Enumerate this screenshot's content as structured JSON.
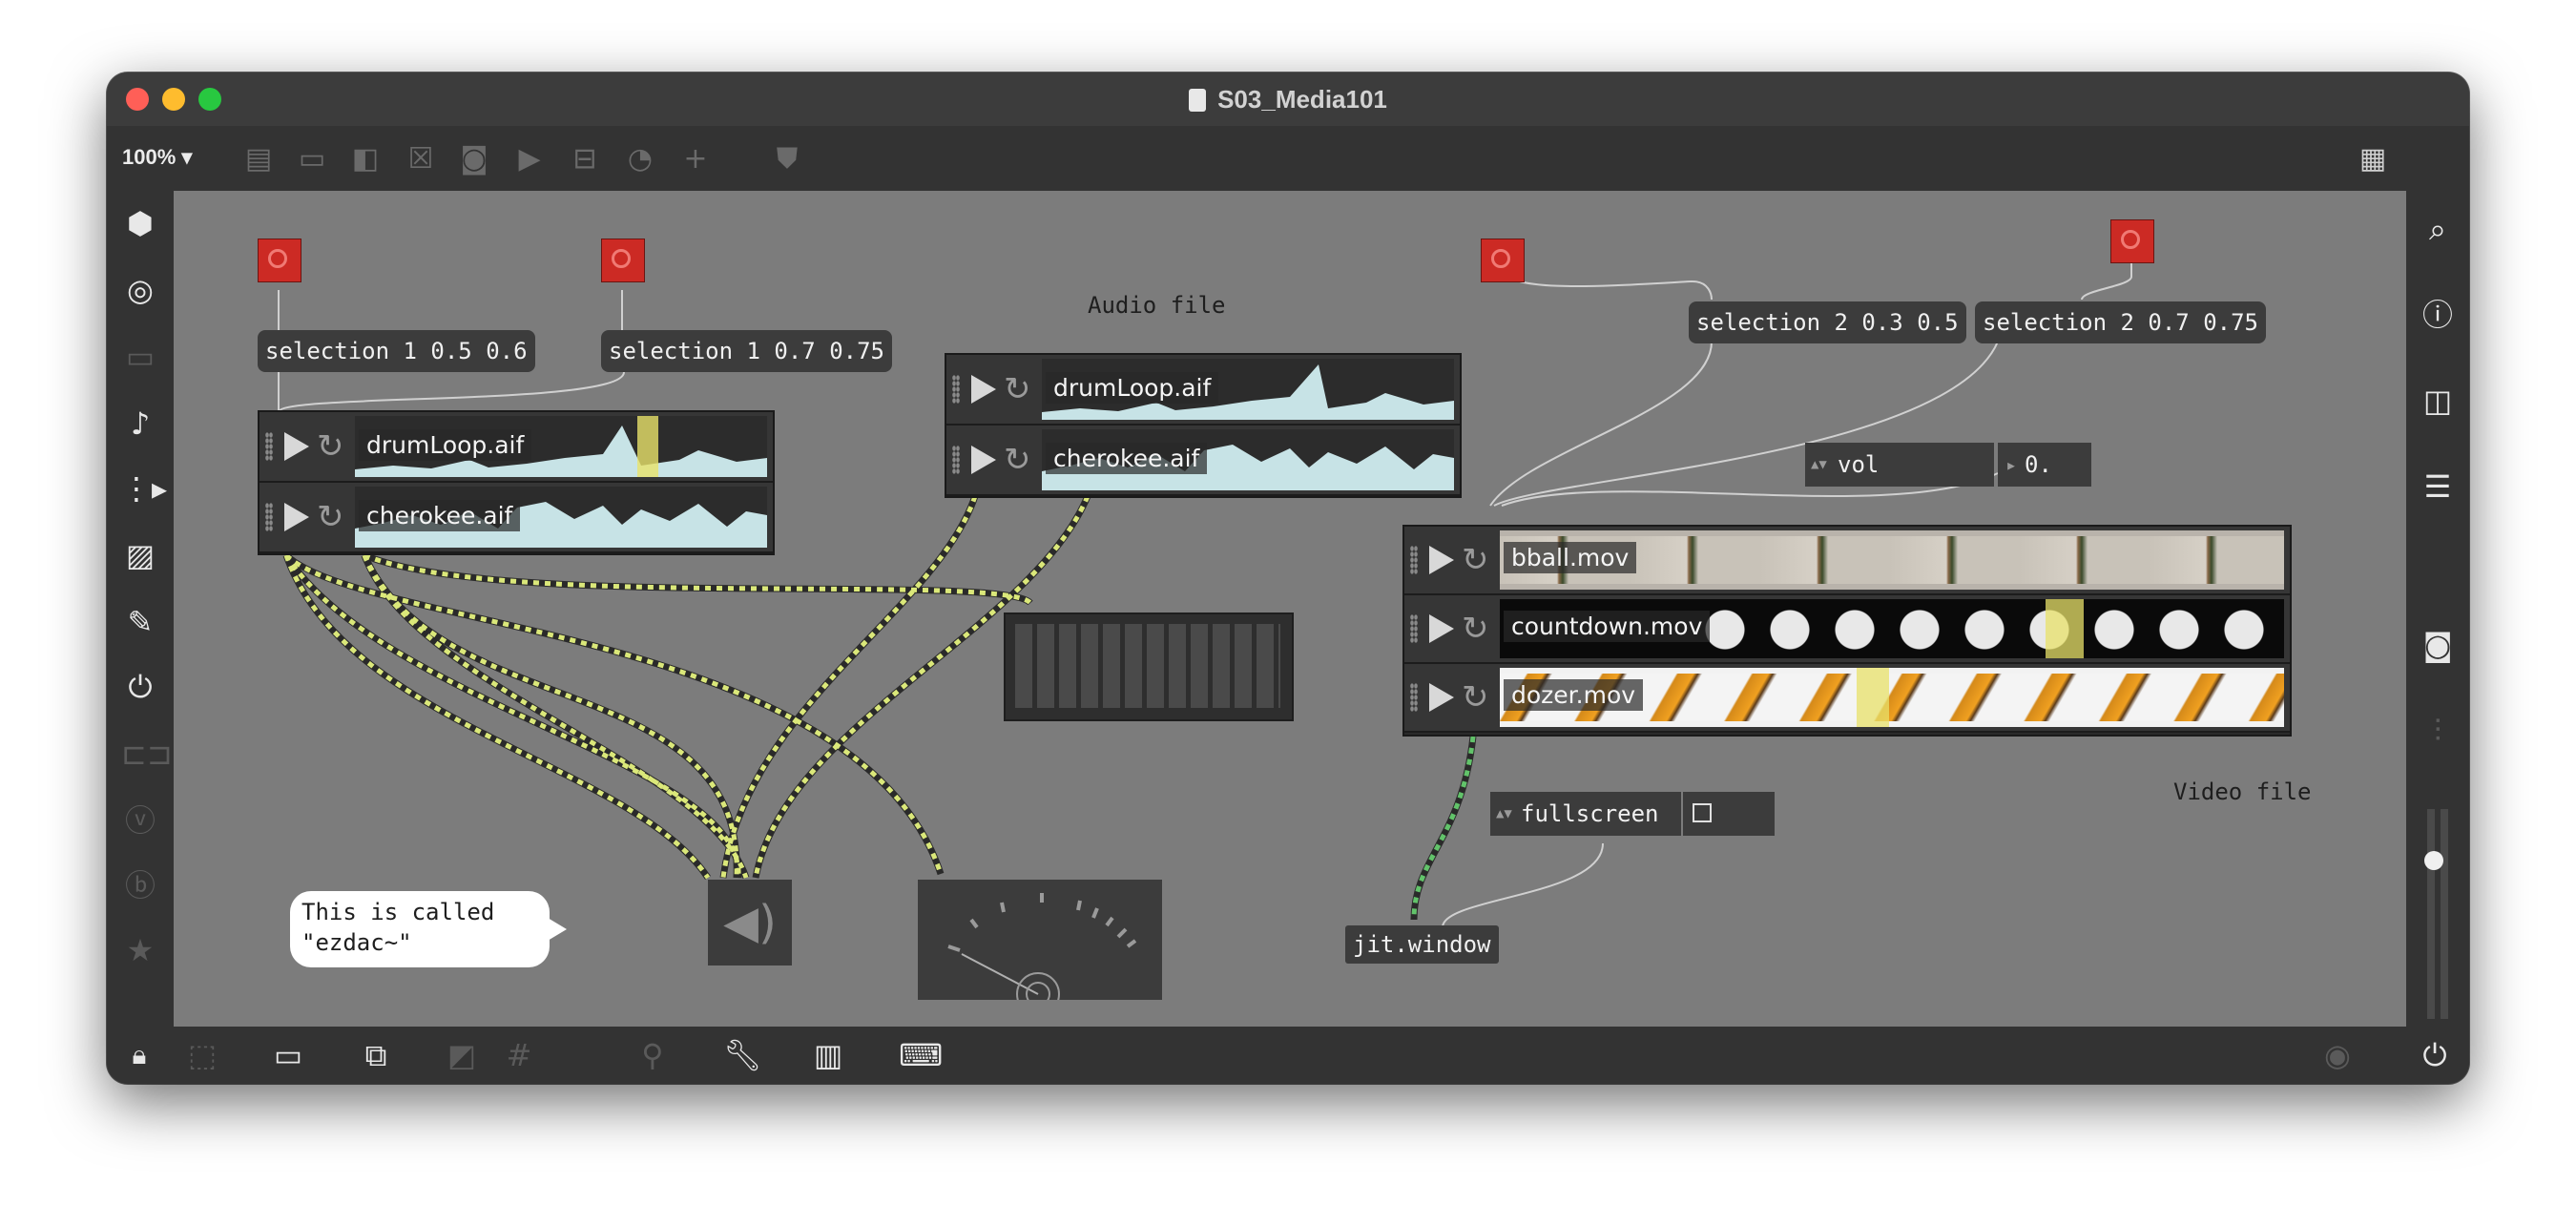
{
  "window": {
    "title": "S03_Media101",
    "zoom": "100%",
    "traffic_colors": {
      "close": "#ff5f57",
      "minimize": "#febc2e",
      "maximize": "#28c840"
    }
  },
  "toolbar": {
    "icons": [
      "new-object-icon",
      "message-icon",
      "comment-icon",
      "toggle-icon",
      "button-icon",
      "number-icon",
      "slider-icon",
      "dial-icon",
      "plus-icon",
      "paint-bucket-icon",
      "grid-menu-icon"
    ]
  },
  "left_sidebar": {
    "icons": [
      "cube-icon",
      "target-icon",
      "filmstrip-icon",
      "music-note-icon",
      "sequence-icon",
      "image-icon",
      "paperclip-icon",
      "plug-icon",
      "connector-icon",
      "vimeo-icon",
      "beap-icon",
      "star-icon"
    ]
  },
  "right_sidebar": {
    "icons": [
      "search-icon",
      "info-icon",
      "split-view-icon",
      "list-icon",
      "camera-icon",
      "mixer-icon",
      "volume-slider-icon",
      "power-icon"
    ]
  },
  "bottom_bar": {
    "icons": [
      "lock-icon",
      "presentation-mode-icon",
      "presentation-icon",
      "windows-icon",
      "hide-icon",
      "grid-icon",
      "add-patcher-icon",
      "wrench-icon",
      "piano-icon",
      "keyboard-icon",
      "run-icon"
    ]
  },
  "patch": {
    "messages": {
      "sel_1_05_06": "selection 1 0.5 0.6",
      "sel_1_07_075": "selection 1 0.7 0.75",
      "sel_2_03_05": "selection 2 0.3 0.5",
      "sel_2_07_075": "selection 2 0.7 0.75"
    },
    "comments": {
      "audio_file": "Audio file",
      "video_file": "Video file"
    },
    "audio_playlist_left": {
      "items": [
        "drumLoop.aif",
        "cherokee.aif"
      ]
    },
    "audio_playlist_right": {
      "items": [
        "drumLoop.aif",
        "cherokee.aif"
      ]
    },
    "video_playlist": {
      "items": [
        "bball.mov",
        "countdown.mov",
        "dozer.mov"
      ]
    },
    "vol": {
      "label": "vol",
      "value": "0."
    },
    "fullscreen": {
      "label": "fullscreen"
    },
    "jit_window": "jit.window",
    "bubble_text_line1": "This is called",
    "bubble_text_line2": "\"ezdac~\"",
    "colors": {
      "canvas": "#7c7c7c",
      "button_red": "#cc2a24",
      "patch_cord_audio": "#dbe87a",
      "patch_cord_video": "#62c36a",
      "waveform": "#c7e3e6",
      "selection": "#e8e26a"
    }
  }
}
